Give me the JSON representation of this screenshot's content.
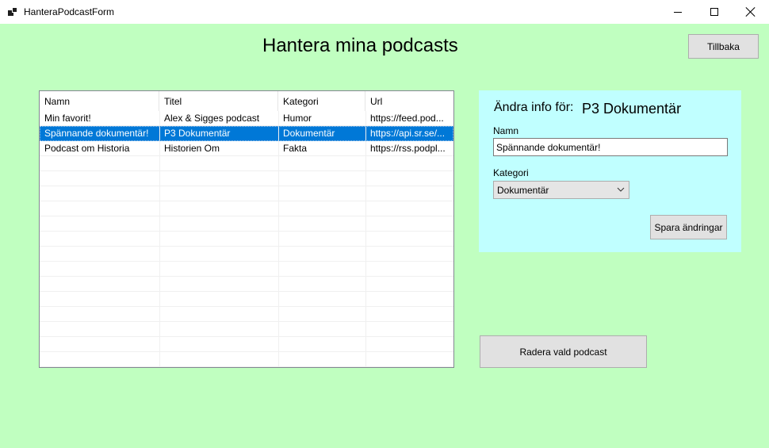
{
  "window": {
    "title": "HanteraPodcastForm"
  },
  "page": {
    "title": "Hantera mina podcasts",
    "back_label": "Tillbaka"
  },
  "list": {
    "columns": [
      "Namn",
      "Titel",
      "Kategori",
      "Url"
    ],
    "rows": [
      {
        "namn": "Min favorit!",
        "titel": "Alex & Sigges podcast",
        "kategori": "Humor",
        "url": "https://feed.pod..."
      },
      {
        "namn": "Spännande dokumentär!",
        "titel": "P3 Dokumentär",
        "kategori": "Dokumentär",
        "url": "https://api.sr.se/...",
        "selected": true
      },
      {
        "namn": "Podcast om Historia",
        "titel": "Historien Om",
        "kategori": "Fakta",
        "url": "https://rss.podpl..."
      }
    ]
  },
  "edit": {
    "heading": "Ändra info för:",
    "current_title": "P3 Dokumentär",
    "name_label": "Namn",
    "name_value": "Spännande dokumentär!",
    "category_label": "Kategori",
    "category_selected": "Dokumentär",
    "save_label": "Spara ändringar"
  },
  "actions": {
    "delete_label": "Radera vald podcast"
  },
  "colors": {
    "form_background": "#c0ffc0",
    "edit_panel_background": "#c0ffff",
    "selection": "#0078d7"
  }
}
